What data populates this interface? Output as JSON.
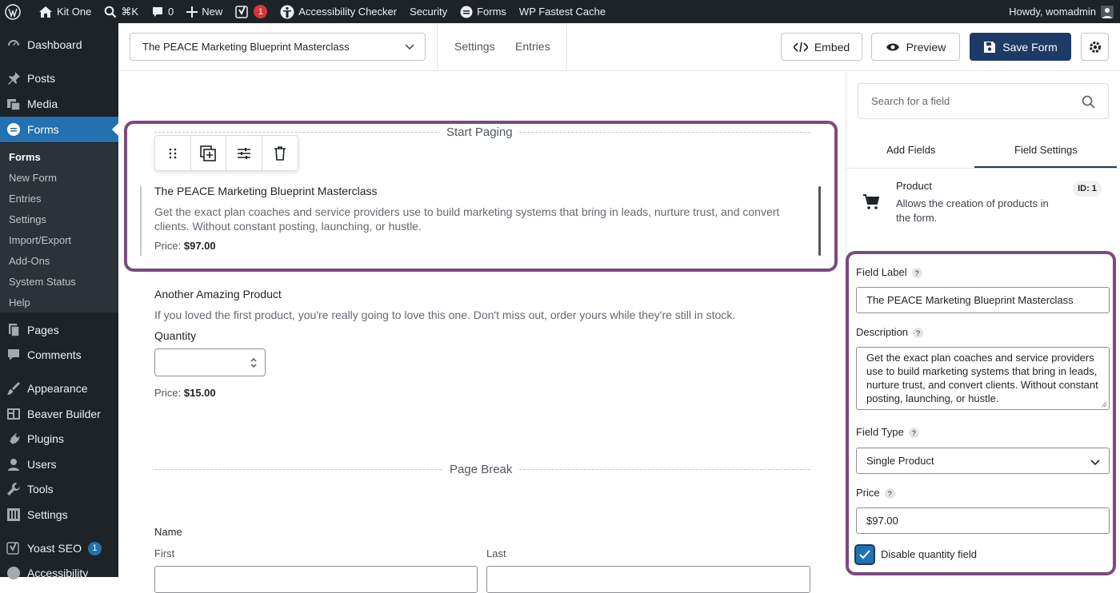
{
  "adminbar": {
    "site_name": "Kit One",
    "search_shortcut": "⌘K",
    "comments_count": "0",
    "new_label": "New",
    "yoast_count": "1",
    "accessibility_label": "Accessibility Checker",
    "security_label": "Security",
    "forms_label": "Forms",
    "cache_label": "WP Fastest Cache",
    "howdy": "Howdy, womadmin"
  },
  "menu": {
    "dashboard": "Dashboard",
    "posts": "Posts",
    "media": "Media",
    "forms": "Forms",
    "sub": [
      "Forms",
      "New Form",
      "Entries",
      "Settings",
      "Import/Export",
      "Add-Ons",
      "System Status",
      "Help"
    ],
    "pages": "Pages",
    "comments": "Comments",
    "appearance": "Appearance",
    "beaver": "Beaver Builder",
    "plugins": "Plugins",
    "users": "Users",
    "tools": "Tools",
    "settings": "Settings",
    "yoast": "Yoast SEO",
    "yoast_badge": "1",
    "accessibility": "Accessibility"
  },
  "topbar": {
    "form_name": "The PEACE Marketing Blueprint Masterclass",
    "settings_tab": "Settings",
    "entries_tab": "Entries",
    "embed": "Embed",
    "preview": "Preview",
    "save": "Save Form"
  },
  "canvas": {
    "start_paging": "Start Paging",
    "product1": {
      "title": "The PEACE Marketing Blueprint Masterclass",
      "desc_line1": "Get the exact plan coaches and service providers use to build marketing systems that bring in leads, nurture trust, and convert",
      "desc_line2": "clients. Without constant posting, launching, or hustle.",
      "price_label": "Price:",
      "price": "$97.00"
    },
    "product2": {
      "title": "Another Amazing Product",
      "desc": "If you loved the first product, you're really going to love this one. Don't miss out, order yours while they're still in stock.",
      "quantity_label": "Quantity",
      "price_label": "Price:",
      "price": "$15.00"
    },
    "page_break": "Page Break",
    "name": {
      "label": "Name",
      "first": "First",
      "last": "Last"
    }
  },
  "panel": {
    "search_placeholder": "Search for a field",
    "tab_add": "Add Fields",
    "tab_settings": "Field Settings",
    "field_type_name": "Product",
    "field_type_desc_line1": "Allows the creation of products in",
    "field_type_desc_line2": "the form.",
    "field_id": "ID: 1",
    "label_label": "Field Label",
    "label_value": "The PEACE Marketing Blueprint Masterclass",
    "desc_label": "Description",
    "desc_lines": [
      "Get the exact plan coaches and service providers",
      "use to build marketing systems that bring in leads,",
      "nurture trust, and convert clients. Without constant",
      "posting, launching, or hustle."
    ],
    "type_label": "Field Type",
    "type_value": "Single Product",
    "price_label": "Price",
    "price_value": "$97.00",
    "disable_qty": "Disable quantity field",
    "help_mark": "?"
  },
  "colors": {
    "highlight": "#7c4a7e",
    "primary": "#1e3a66",
    "wp_blue": "#2271b1"
  }
}
